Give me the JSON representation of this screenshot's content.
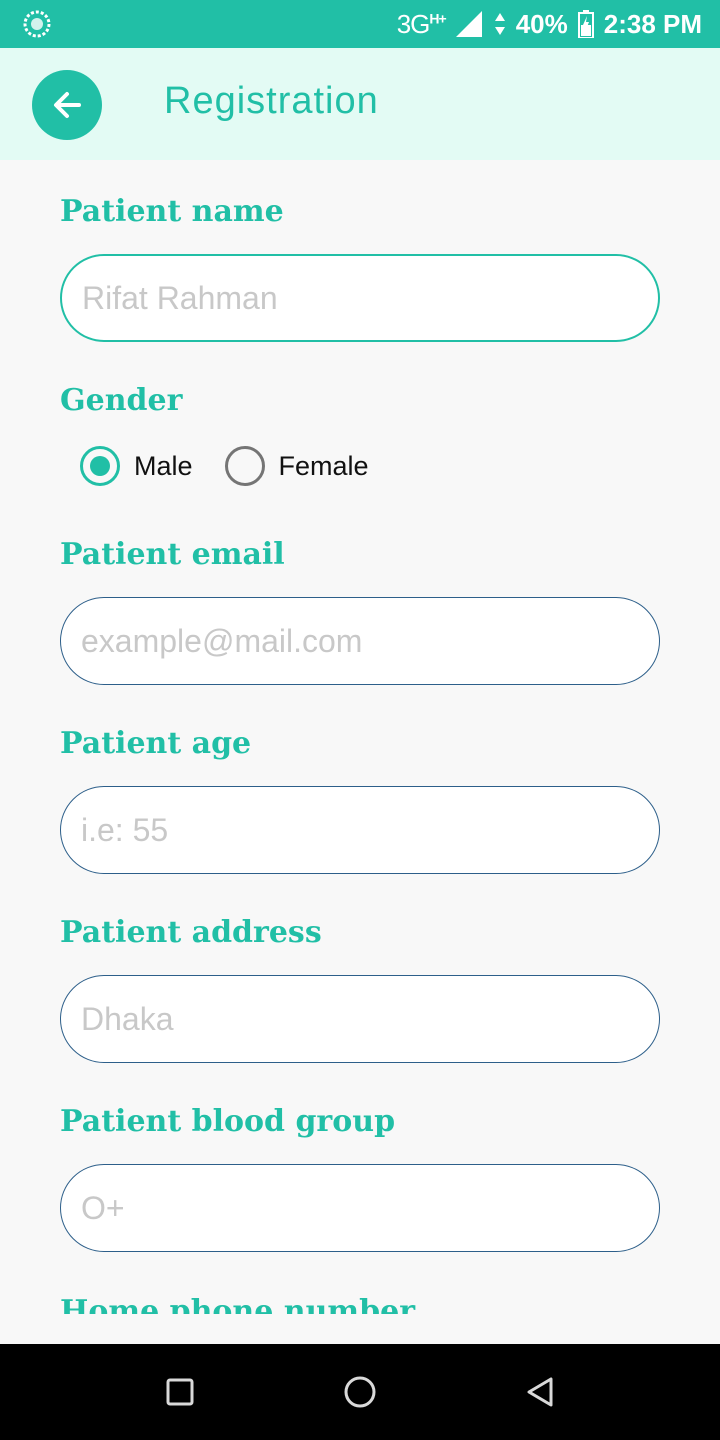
{
  "status_bar": {
    "network": "3G",
    "network_sup": "H+",
    "battery": "40%",
    "time": "2:38 PM"
  },
  "app_bar": {
    "title": "Registration",
    "back_icon": "arrow-left-icon"
  },
  "form": {
    "patient_name": {
      "label": "Patient name",
      "placeholder": "Rifat Rahman",
      "value": ""
    },
    "gender": {
      "label": "Gender",
      "options": [
        {
          "label": "Male",
          "checked": true
        },
        {
          "label": "Female",
          "checked": false
        }
      ]
    },
    "patient_email": {
      "label": "Patient email",
      "placeholder": "example@mail.com",
      "value": ""
    },
    "patient_age": {
      "label": "Patient age",
      "placeholder": "i.e: 55",
      "value": ""
    },
    "patient_address": {
      "label": "Patient address",
      "placeholder": "Dhaka",
      "value": ""
    },
    "patient_blood_group": {
      "label": "Patient blood group",
      "placeholder": "O+",
      "value": ""
    },
    "home_phone": {
      "label": "Home phone number"
    }
  },
  "colors": {
    "accent": "#21BFA6",
    "app_bar_bg": "#E3FBF4",
    "input_border": "#2D5F8A"
  }
}
